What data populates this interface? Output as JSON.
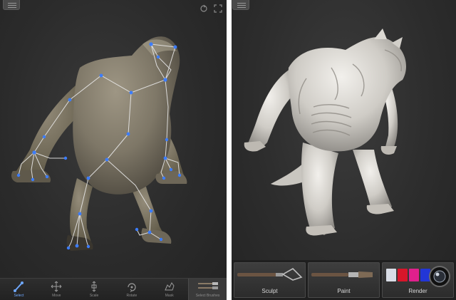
{
  "left_screen": {
    "toolbar": {
      "items": [
        {
          "icon": "pose-icon",
          "label": "Select",
          "active": true
        },
        {
          "icon": "move-icon",
          "label": "Move",
          "active": false
        },
        {
          "icon": "scale-icon",
          "label": "Scale",
          "active": false
        },
        {
          "icon": "rotate-icon",
          "label": "Rotate",
          "active": false
        },
        {
          "icon": "mask-icon",
          "label": "Mask",
          "active": false
        },
        {
          "icon": "brushes-icon",
          "label": "Select Brushes",
          "active": false
        }
      ]
    },
    "joint_color": "#3c7dff",
    "bone_color": "#e8e8e8"
  },
  "right_screen": {
    "tiles": [
      {
        "label": "Sculpt",
        "icon": "sculpt-tool-icon"
      },
      {
        "label": "Paint",
        "icon": "paint-brush-icon"
      },
      {
        "label": "Render",
        "icon": "render-materials-icon"
      }
    ],
    "palette_colors": [
      "#d9dde6",
      "#d8162a",
      "#e0208c",
      "#2236d6"
    ]
  }
}
